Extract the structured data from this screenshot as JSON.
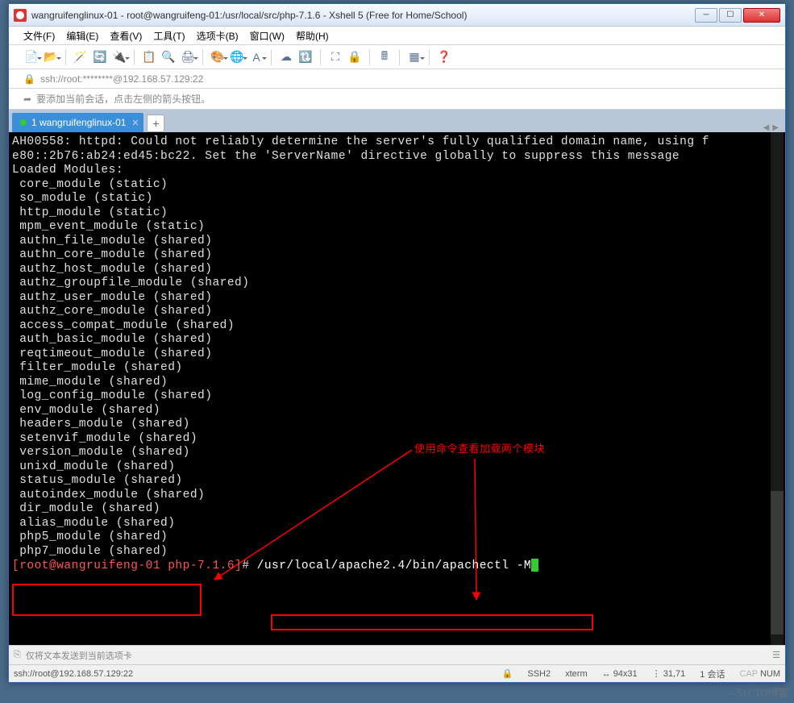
{
  "title": "wangruifenglinux-01 - root@wangruifeng-01:/usr/local/src/php-7.1.6 - Xshell 5 (Free for Home/School)",
  "menu": [
    "文件(F)",
    "编辑(E)",
    "查看(V)",
    "工具(T)",
    "选项卡(B)",
    "窗口(W)",
    "帮助(H)"
  ],
  "ssh_url": "ssh://root:********@192.168.57.129:22",
  "hint_text": "要添加当前会话，点击左侧的箭头按钮。",
  "tab_name": "1 wangruifenglinux-01",
  "terminal_lines": [
    "AH00558: httpd: Could not reliably determine the server's fully qualified domain name, using f",
    "e80::2b76:ab24:ed45:bc22. Set the 'ServerName' directive globally to suppress this message",
    "Loaded Modules:",
    " core_module (static)",
    " so_module (static)",
    " http_module (static)",
    " mpm_event_module (static)",
    " authn_file_module (shared)",
    " authn_core_module (shared)",
    " authz_host_module (shared)",
    " authz_groupfile_module (shared)",
    " authz_user_module (shared)",
    " authz_core_module (shared)",
    " access_compat_module (shared)",
    " auth_basic_module (shared)",
    " reqtimeout_module (shared)",
    " filter_module (shared)",
    " mime_module (shared)",
    " log_config_module (shared)",
    " env_module (shared)",
    " headers_module (shared)",
    " setenvif_module (shared)",
    " version_module (shared)",
    " unixd_module (shared)",
    " status_module (shared)",
    " autoindex_module (shared)",
    " dir_module (shared)",
    " alias_module (shared)",
    " php5_module (shared)",
    " php7_module (shared)"
  ],
  "prompt_user": "[root@wangruifeng-01 php-7.1.6]",
  "prompt_sep": "# ",
  "prompt_cmd": "/usr/local/apache2.4/bin/apachectl -M",
  "annotation_text": "使用命令查看加载两个模块",
  "input_placeholder": "仅将文本发送到当前选项卡",
  "status": {
    "conn": "ssh://root@192.168.57.129:22",
    "ssh": "SSH2",
    "term": "xterm",
    "size": "94x31",
    "pos": "31,71",
    "sessions": "1 会话",
    "cap": "CAP",
    "num": "NUM"
  },
  "watermark": "--51CTO博客"
}
